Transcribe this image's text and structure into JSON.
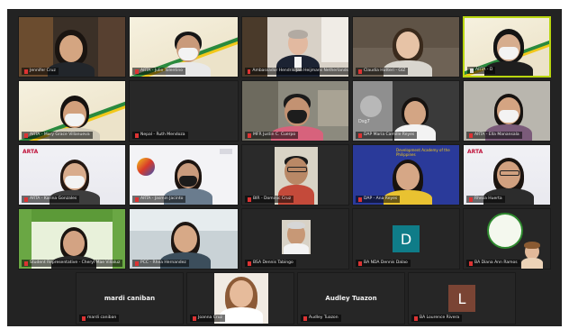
{
  "tiles": [
    {
      "id": "t1",
      "label": "Jennifer Cruz",
      "active": false
    },
    {
      "id": "t2",
      "label": "ARTA - Julie Tolentino",
      "active": false
    },
    {
      "id": "t3",
      "label": "Ambassador Hendrik Jan Heijmans Netherlands",
      "active": false
    },
    {
      "id": "t4",
      "label": "Claudia Hutteri - GIZ",
      "active": false
    },
    {
      "id": "t5",
      "label": "ARTA - D",
      "active": true
    },
    {
      "id": "t6",
      "label": "ARTA - Mary Grace Villanueva",
      "active": false
    },
    {
      "id": "t7",
      "label": "Nepal - Ruth Mendoza",
      "active": false
    },
    {
      "id": "t8",
      "label": "MFR Justin C. Cuerpo",
      "active": false
    },
    {
      "id": "t9",
      "label": "DAP Maria Camille Reyes",
      "active": false
    },
    {
      "id": "t10",
      "label": "ARTA - Ella Manansala",
      "active": false
    },
    {
      "id": "t11",
      "label": "ARTA - Karina Gonzales",
      "active": false
    },
    {
      "id": "t12",
      "label": "ARTA - Jasmin Jacinto",
      "active": false
    },
    {
      "id": "t13",
      "label": "BIR - Dominic Cruz",
      "active": false
    },
    {
      "id": "t14",
      "label": "DAP - Ana Reyes",
      "active": false
    },
    {
      "id": "t15",
      "label": "Rheza Huerta",
      "active": false
    },
    {
      "id": "t16",
      "label": "Student Representative - Cheryl Mae Villaluz",
      "active": false
    },
    {
      "id": "t17",
      "label": "PCC - Rhea Hernandez",
      "active": false
    },
    {
      "id": "t18",
      "label": "BSA Dennis Tabingo",
      "active": false
    },
    {
      "id": "t19",
      "label": "BA NDA Dennis Dalao",
      "active": false
    },
    {
      "id": "t20",
      "label": "BA Diana Ann Ramos",
      "active": false
    },
    {
      "id": "t21",
      "label": "mardi caniban",
      "active": false
    },
    {
      "id": "t22",
      "label": "Joanna Cruz",
      "active": false
    },
    {
      "id": "t23",
      "label": "Audley Tuazon",
      "active": false
    },
    {
      "id": "t24",
      "label": "BA Lourence Rivera",
      "active": false
    }
  ],
  "center_names": {
    "t21": "mardi caniban",
    "t23": "Audley Tuazon"
  },
  "initials": {
    "t19": "D",
    "t24": "L"
  },
  "t9_icon_text": "Dsg7",
  "arta_text": "ARTA",
  "t14_banner": "Development Academy of the Philippines",
  "colors": {
    "active_border": "#b9d60f",
    "teal": "#0f7c88",
    "brown": "#7a4434"
  }
}
